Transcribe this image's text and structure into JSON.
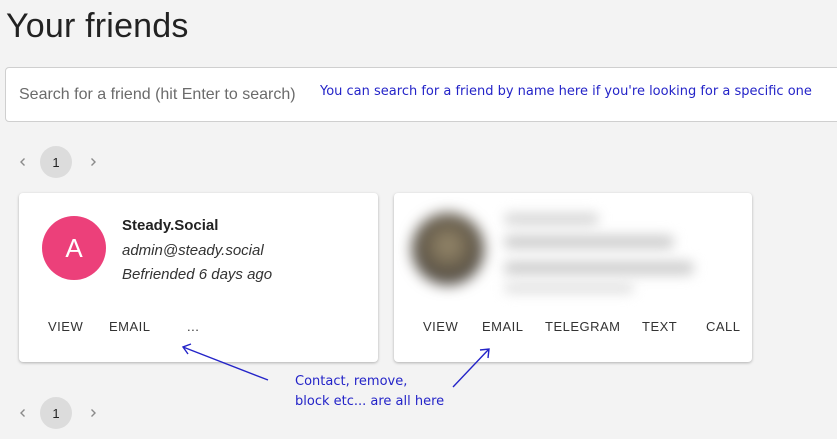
{
  "page": {
    "title": "Your friends"
  },
  "search": {
    "placeholder": "Search for a friend (hit Enter to search)",
    "value": ""
  },
  "annotations": {
    "search_hint": "You can search for a friend by name here if you're looking for a specific one",
    "contact_hint_line1": "Contact, remove,",
    "contact_hint_line2": "block etc... are all here"
  },
  "pagination": {
    "current_page": "1",
    "prev_icon": "chevron-left-icon",
    "next_icon": "chevron-right-icon"
  },
  "friends": [
    {
      "avatar_letter": "A",
      "avatar_color": "#ec407a",
      "name": "Steady.Social",
      "email": "admin@steady.social",
      "befriended": "Befriended 6 days ago",
      "actions": [
        "VIEW",
        "EMAIL",
        "..."
      ]
    },
    {
      "redacted": true,
      "actions": [
        "VIEW",
        "EMAIL",
        "TELEGRAM",
        "TEXT",
        "CALL"
      ]
    }
  ],
  "colors": {
    "background": "#f3f3f3",
    "annotation": "#2424c8",
    "avatar": "#ec407a",
    "card": "#ffffff"
  }
}
